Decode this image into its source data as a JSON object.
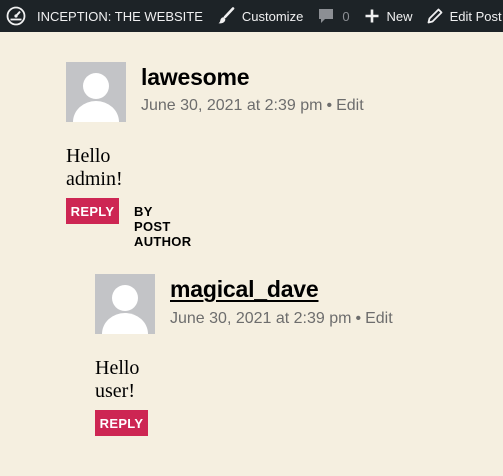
{
  "admin_bar": {
    "site_name": "INCEPTION: THE WEBSITE",
    "customize": "Customize",
    "comments_count": "0",
    "new": "New",
    "edit_post": "Edit Post"
  },
  "comments": [
    {
      "author": "lawesome",
      "date": "June 30, 2021 at 2:39 pm",
      "separator": "•",
      "edit": "Edit",
      "text": "Hello admin!",
      "reply": "REPLY",
      "badge": "BY POST AUTHOR"
    },
    {
      "author": "magical_dave",
      "date": "June 30, 2021 at 2:39 pm",
      "separator": "•",
      "edit": "Edit",
      "text": "Hello user!",
      "reply": "REPLY"
    }
  ],
  "colors": {
    "admin_bar_bg": "#1d2327",
    "page_bg": "#f5efe0",
    "accent": "#cd2653",
    "meta_text": "#6d6d6d"
  }
}
